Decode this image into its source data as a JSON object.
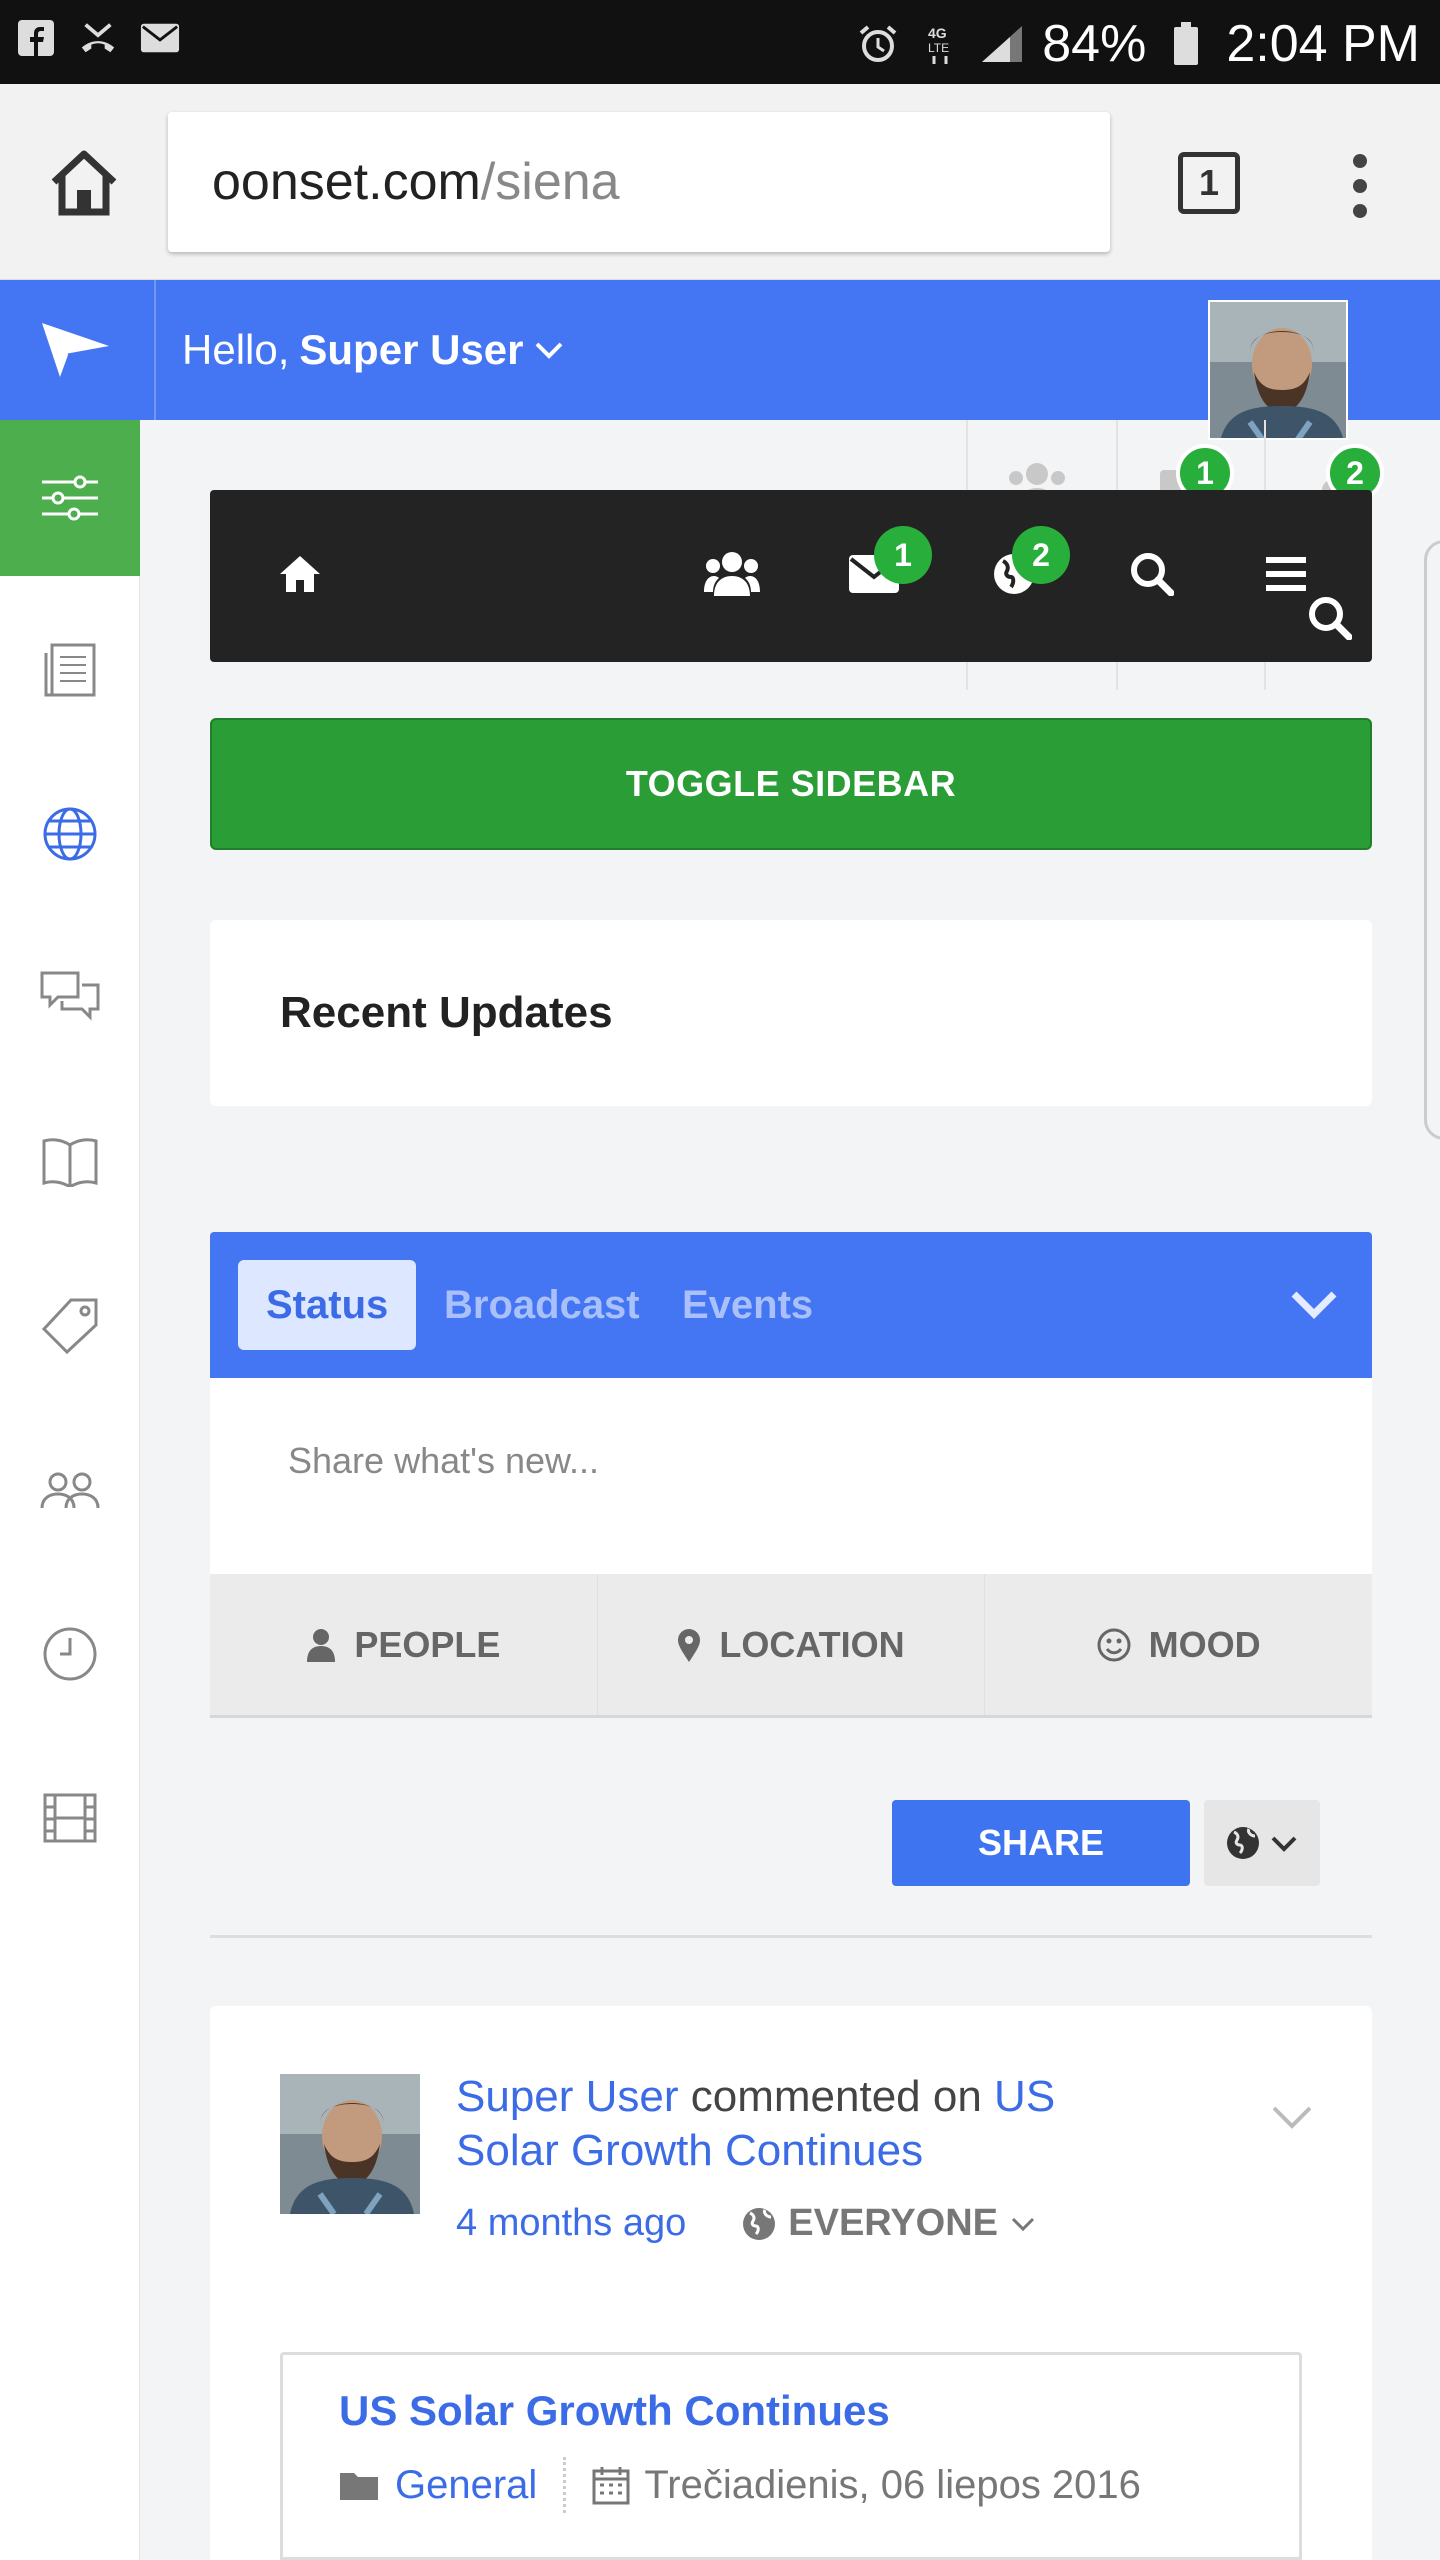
{
  "status_bar": {
    "battery": "84%",
    "time": "2:04 PM"
  },
  "browser": {
    "url_domain": "oonset.com",
    "url_path": "/siena",
    "tab_count": "1"
  },
  "header": {
    "greeting": "Hello,",
    "user_name": "Super User"
  },
  "nav": {
    "messages_badge": "1",
    "notifications_badge": "2",
    "ghost_messages_badge": "1",
    "ghost_notifications_badge": "2"
  },
  "toggle_sidebar_label": "TOGGLE SIDEBAR",
  "recent_updates_title": "Recent Updates",
  "composer": {
    "tabs": [
      {
        "label": "Status",
        "active": true
      },
      {
        "label": "Broadcast",
        "active": false
      },
      {
        "label": "Events",
        "active": false
      }
    ],
    "placeholder": "Share what's new...",
    "options": {
      "people": "PEOPLE",
      "location": "LOCATION",
      "mood": "MOOD"
    },
    "share_label": "SHARE"
  },
  "feed_item": {
    "actor": "Super User",
    "action": " commented on ",
    "target": "US Solar Growth Continues",
    "time": "4 months ago",
    "privacy": "EVERYONE",
    "embed": {
      "title": "US Solar Growth Continues",
      "category": "General",
      "date": "Trečiadienis, 06 liepos 2016"
    }
  },
  "colors": {
    "primary_blue": "#4475f2",
    "green": "#2a9d36",
    "dark_nav": "#232323"
  }
}
